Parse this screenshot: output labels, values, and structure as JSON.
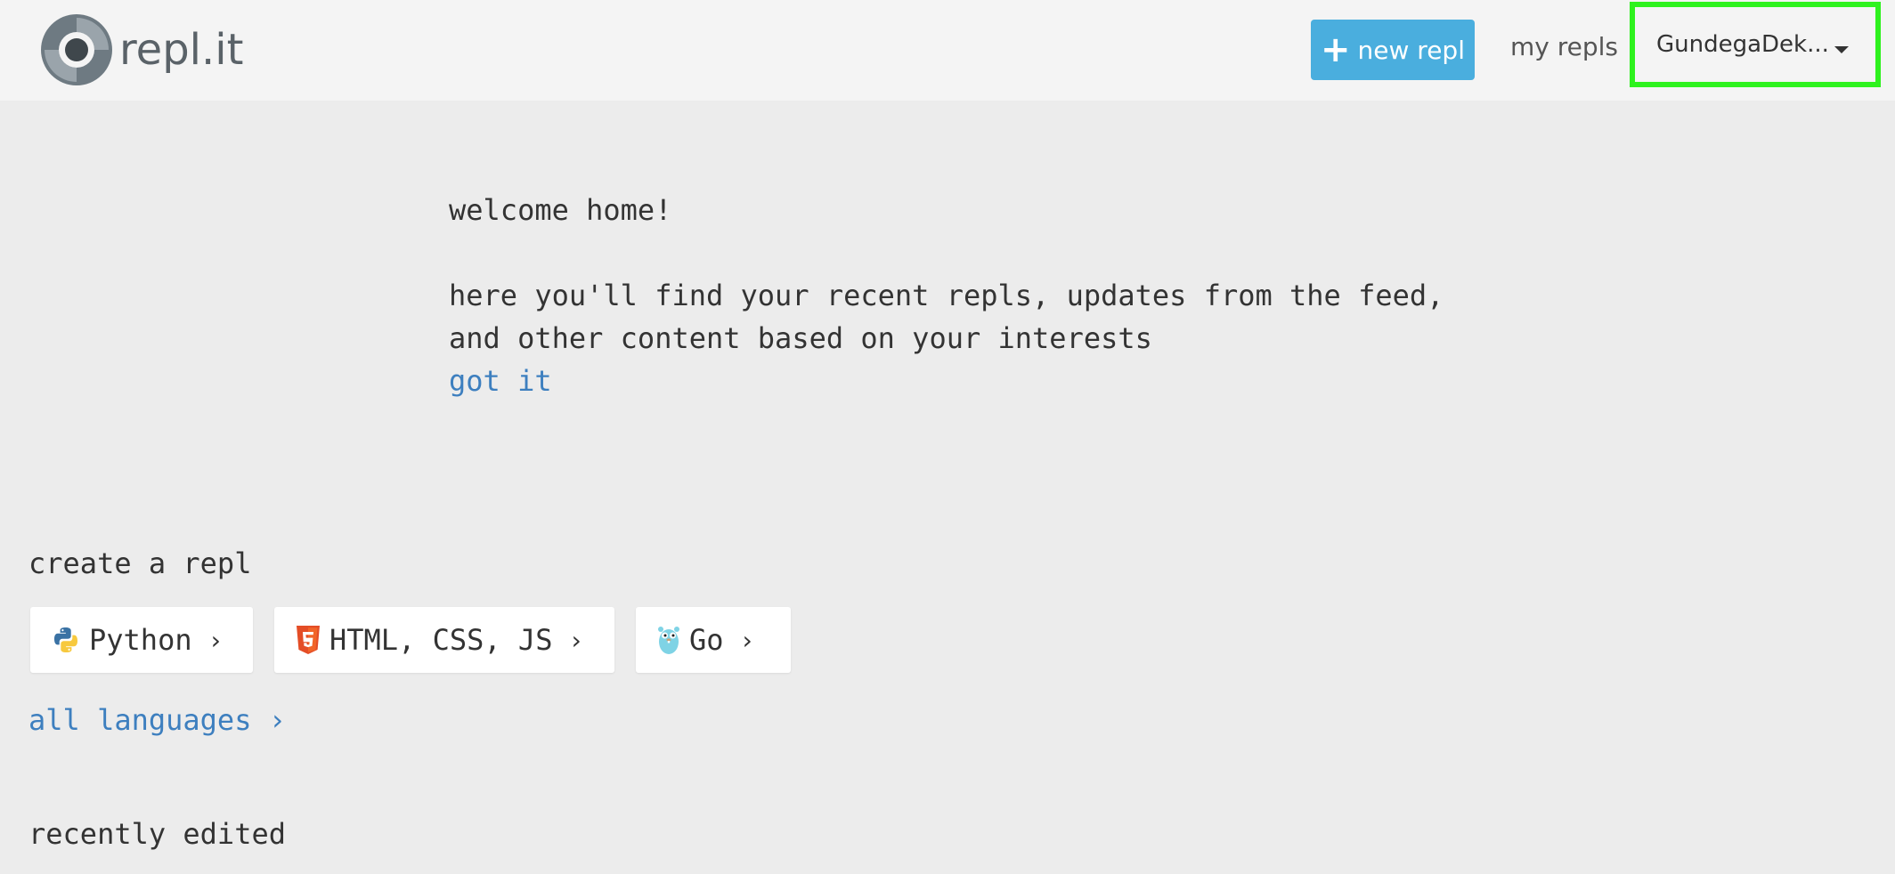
{
  "header": {
    "logo_text": "repl.it",
    "new_repl_label": "new repl",
    "my_repls_label": "my repls",
    "user_name": "GundegaDek..."
  },
  "welcome": {
    "line1": "welcome home!",
    "line2": "here you'll find your recent repls, updates from the feed,",
    "line3": "and other content based on your interests",
    "got_it": "got it"
  },
  "create": {
    "title": "create a repl",
    "languages": [
      {
        "label": "Python",
        "icon": "python-icon"
      },
      {
        "label": "HTML, CSS, JS",
        "icon": "html5-icon"
      },
      {
        "label": "Go",
        "icon": "gopher-icon"
      }
    ],
    "chevron": "›",
    "all_languages": "all languages ›"
  },
  "recent": {
    "title": "recently edited"
  },
  "colors": {
    "accent": "#4aaede",
    "link": "#3d7fbf",
    "highlight": "#2ef21e",
    "background": "#ececec",
    "header": "#f4f4f4"
  }
}
